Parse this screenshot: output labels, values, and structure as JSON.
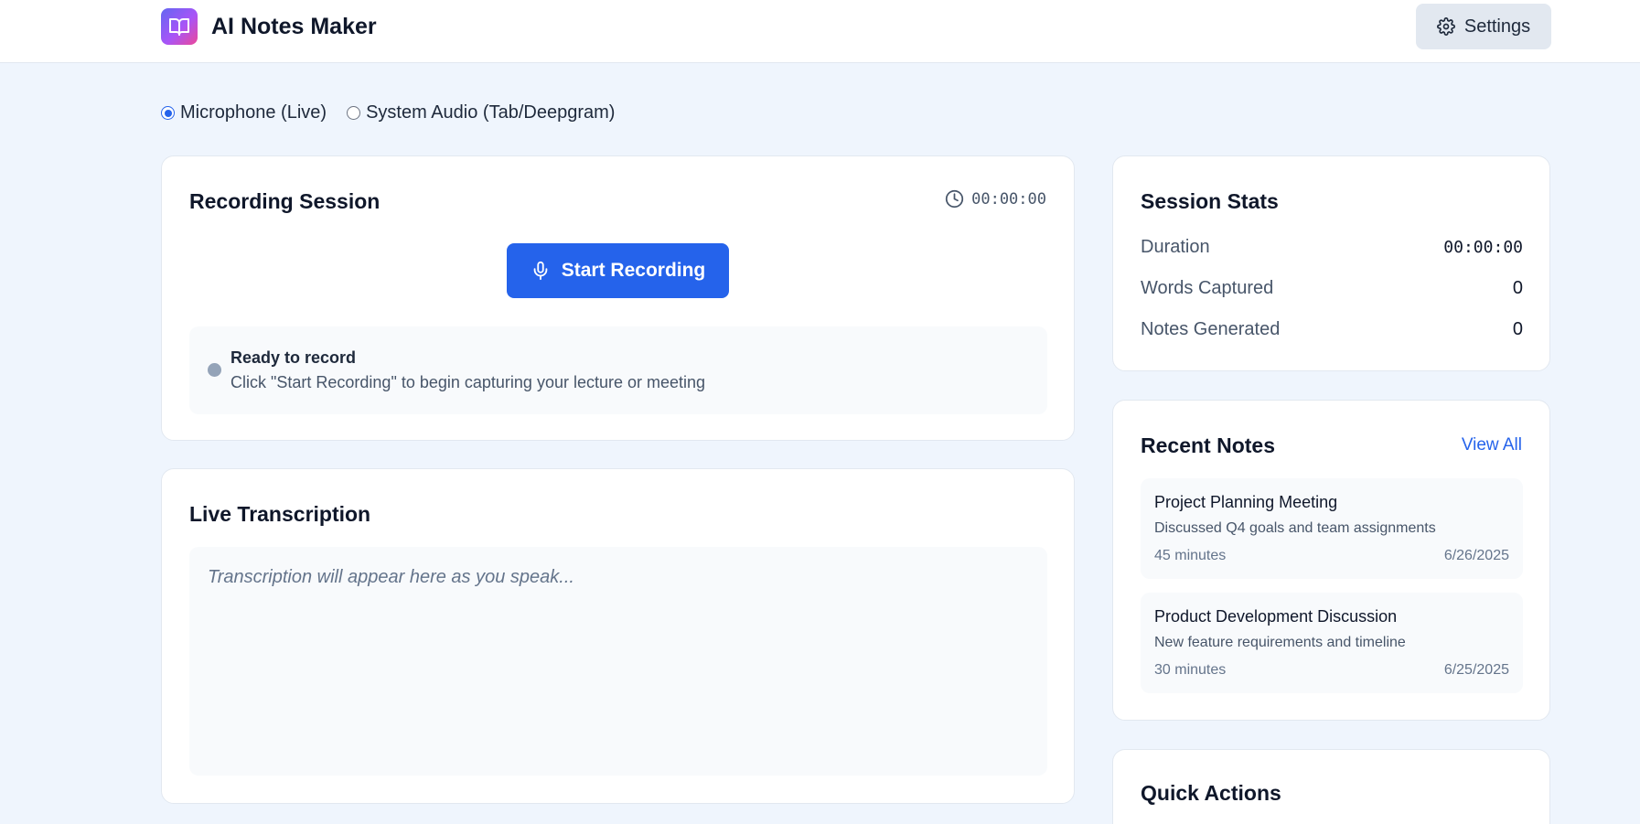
{
  "header": {
    "app_title": "AI Notes Maker",
    "settings_label": "Settings"
  },
  "audio_source": {
    "options": [
      {
        "label": "Microphone (Live)",
        "selected": true
      },
      {
        "label": "System Audio (Tab/Deepgram)",
        "selected": false
      }
    ]
  },
  "recording": {
    "title": "Recording Session",
    "timer": "00:00:00",
    "start_label": "Start Recording",
    "status_title": "Ready to record",
    "status_desc": "Click \"Start Recording\" to begin capturing your lecture or meeting"
  },
  "transcription": {
    "title": "Live Transcription",
    "placeholder": "Transcription will appear here as you speak..."
  },
  "stats": {
    "title": "Session Stats",
    "rows": [
      {
        "label": "Duration",
        "value": "00:00:00"
      },
      {
        "label": "Words Captured",
        "value": "0"
      },
      {
        "label": "Notes Generated",
        "value": "0"
      }
    ]
  },
  "recent_notes": {
    "title": "Recent Notes",
    "view_all": "View All",
    "items": [
      {
        "title": "Project Planning Meeting",
        "desc": "Discussed Q4 goals and team assignments",
        "duration": "45 minutes",
        "date": "6/26/2025"
      },
      {
        "title": "Product Development Discussion",
        "desc": "New feature requirements and timeline",
        "duration": "30 minutes",
        "date": "6/25/2025"
      }
    ]
  },
  "quick_actions": {
    "title": "Quick Actions"
  },
  "colors": {
    "accent": "#2563eb",
    "background": "#eff5fd",
    "status_idle": "#94a3b8"
  }
}
